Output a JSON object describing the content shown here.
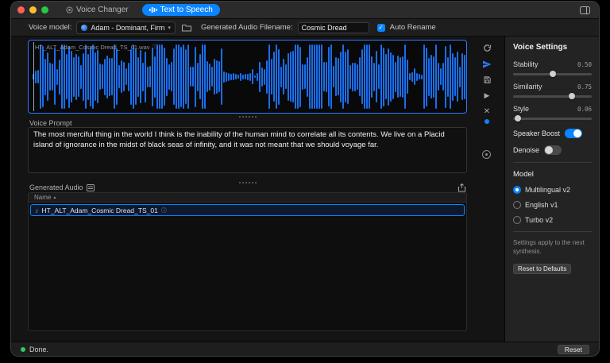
{
  "titlebar": {
    "tabs": [
      {
        "label": "Voice Changer"
      },
      {
        "label": "Text to Speech"
      }
    ]
  },
  "toolbar": {
    "voice_model_label": "Voice model:",
    "voice_model_value": "Adam - Dominant, Firm",
    "filename_label": "Generated Audio Filename:",
    "filename_value": "Cosmic Dread",
    "auto_rename_label": "Auto Rename"
  },
  "waveform": {
    "filename": "HT_ALT_Adam_Cosmic Dread_TS_01.wav"
  },
  "voice_prompt": {
    "label": "Voice Prompt",
    "text": "The most merciful thing in the world I think is the inability of the human mind to correlate all its contents. We live on a Placid island of ignorance in the midst of black seas of infinity, and it was not meant that we should voyage far."
  },
  "generated_audio": {
    "label": "Generated Audio",
    "column_header": "Name",
    "rows": [
      {
        "name": "HT_ALT_Adam_Cosmic Dread_TS_01"
      }
    ]
  },
  "voice_settings": {
    "title": "Voice Settings",
    "sliders": [
      {
        "label": "Stability",
        "value": "0.50",
        "pct": 50
      },
      {
        "label": "Similarity",
        "value": "0.75",
        "pct": 75
      },
      {
        "label": "Style",
        "value": "0.06",
        "pct": 6
      }
    ],
    "toggles": [
      {
        "label": "Speaker Boost",
        "on": true
      },
      {
        "label": "Denoise",
        "on": false
      }
    ],
    "model_label": "Model",
    "models": [
      {
        "label": "Multilingual v2",
        "selected": true
      },
      {
        "label": "English v1",
        "selected": false
      },
      {
        "label": "Turbo v2",
        "selected": false
      }
    ],
    "note": "Settings apply to the next synthesis.",
    "reset_button_label": "Reset to Defaults"
  },
  "statusbar": {
    "status_text": "Done.",
    "reset_button_label": "Reset"
  },
  "icons": {
    "check": "✓",
    "chevron_down": "▾",
    "play": "▶",
    "close": "✕",
    "note": "♪",
    "info": "ⓘ",
    "sort_asc": "▲"
  },
  "colors": {
    "accent": "#0a84ff",
    "waveform_blue": "#1a6ef0",
    "status_green": "#2ecc5e"
  }
}
